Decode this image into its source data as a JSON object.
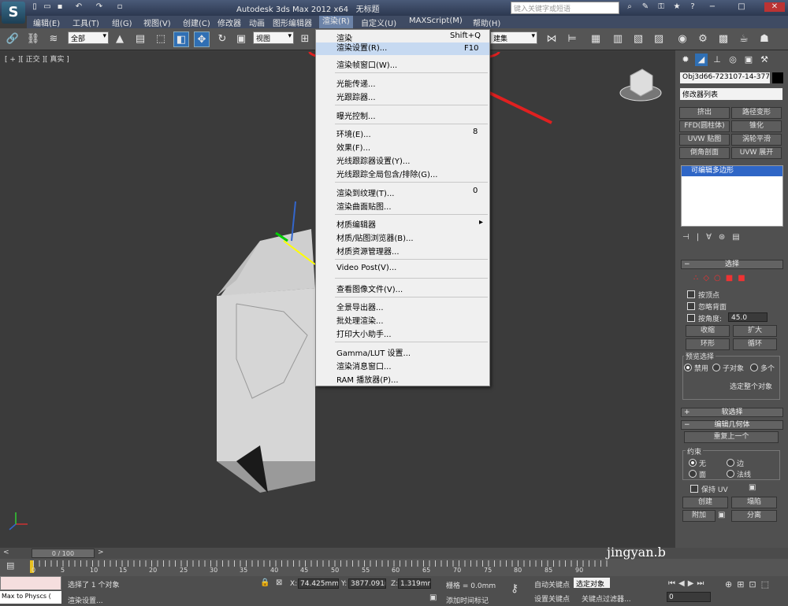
{
  "title": {
    "app": "Autodesk 3ds Max  2012 x64",
    "doc": "无标题"
  },
  "search": {
    "placeholder": "键入关键字或短语"
  },
  "menu": [
    "编辑(E)",
    "工具(T)",
    "组(G)",
    "视图(V)",
    "创建(C)",
    "修改器",
    "动画",
    "图形编辑器",
    "渲染(R)",
    "自定义(U)",
    "MAXScript(M)",
    "帮助(H)"
  ],
  "toolbar": {
    "selection_filter": "全部",
    "ref_coord": "视图",
    "named_sel": "建集"
  },
  "viewport": {
    "label": "[ + ][ 正交 ][ 真实 ]"
  },
  "render_menu": {
    "items": [
      {
        "label": "渲染",
        "shortcut": "Shift+Q"
      },
      {
        "label": "渲染设置(R)...",
        "shortcut": "F10"
      },
      {
        "label": "渲染帧窗口(W)..."
      },
      {
        "label": "光能传递..."
      },
      {
        "label": "光跟踪器..."
      },
      {
        "label": "曝光控制..."
      },
      {
        "label": "环境(E)...",
        "shortcut": "8"
      },
      {
        "label": "效果(F)..."
      },
      {
        "label": "光线跟踪器设置(Y)..."
      },
      {
        "label": "光线跟踪全局包含/排除(G)..."
      },
      {
        "label": "渲染到纹理(T)...",
        "shortcut": "0"
      },
      {
        "label": "渲染曲面贴图..."
      },
      {
        "label": "材质编辑器",
        "submenu": "▸"
      },
      {
        "label": "材质/贴图浏览器(B)..."
      },
      {
        "label": "材质资源管理器..."
      },
      {
        "label": "Video Post(V)..."
      },
      {
        "label": "查看图像文件(V)..."
      },
      {
        "label": "全景导出器..."
      },
      {
        "label": "批处理渲染..."
      },
      {
        "label": "打印大小助手..."
      },
      {
        "label": "Gamma/LUT 设置..."
      },
      {
        "label": "渲染消息窗口..."
      },
      {
        "label": "RAM 播放器(P)..."
      }
    ]
  },
  "command_panel": {
    "object_name": "Obj3d66-723107-14-377",
    "modifier_list": "修改器列表",
    "modifier_buttons": [
      "挤出",
      "路径变形",
      "FFD(圆柱体)",
      "锥化",
      "UVW 贴图",
      "涡轮平滑",
      "倒角剖面",
      "UVW 展开"
    ],
    "stack_item": "可编辑多边形",
    "rollout_selection": "选择",
    "by_vertex": "按顶点",
    "ignore_backfacing": "忽略背面",
    "by_angle": "按角度:",
    "angle_value": "45.0",
    "shrink": "收缩",
    "grow": "扩大",
    "ring": "环形",
    "loop": "循环",
    "preview_selection": "预览选择",
    "preview_off": "禁用",
    "preview_subobj": "子对象",
    "preview_multi": "多个",
    "selected_whole": "选定整个对象",
    "rollout_soft": "软选择",
    "rollout_edit_geom": "编辑几何体",
    "repeat_last": "重复上一个",
    "constraints": "约束",
    "c_none": "无",
    "c_edge": "边",
    "c_face": "面",
    "c_normal": "法线",
    "preserve_uv": "保持 UV",
    "create": "创建",
    "collapse": "塌陷",
    "attach": "附加",
    "detach": "分离"
  },
  "timeline": {
    "frame": "0 / 100",
    "ticks": [
      "0",
      "5",
      "10",
      "15",
      "20",
      "25",
      "30",
      "35",
      "40",
      "45",
      "50",
      "55",
      "60",
      "65",
      "70",
      "75",
      "80",
      "85",
      "90"
    ]
  },
  "status": {
    "maxscript": "Max to Physcs (",
    "selected": "选择了 1 个对象",
    "prompt": "渲染设置...",
    "x_label": "X:",
    "x_val": "74.425mm",
    "y_label": "Y:",
    "y_val": "3877.091n",
    "z_label": "Z:",
    "z_val": "1.319mm",
    "grid": "栅格 = 0.0mm",
    "add_time_tag": "添加时间标记",
    "auto_key": "自动关键点",
    "selected_obj": "选定对象",
    "set_key": "设置关键点",
    "key_filters": "关键点过滤器...",
    "frame_field": "0"
  },
  "watermark": "jingyan.b"
}
